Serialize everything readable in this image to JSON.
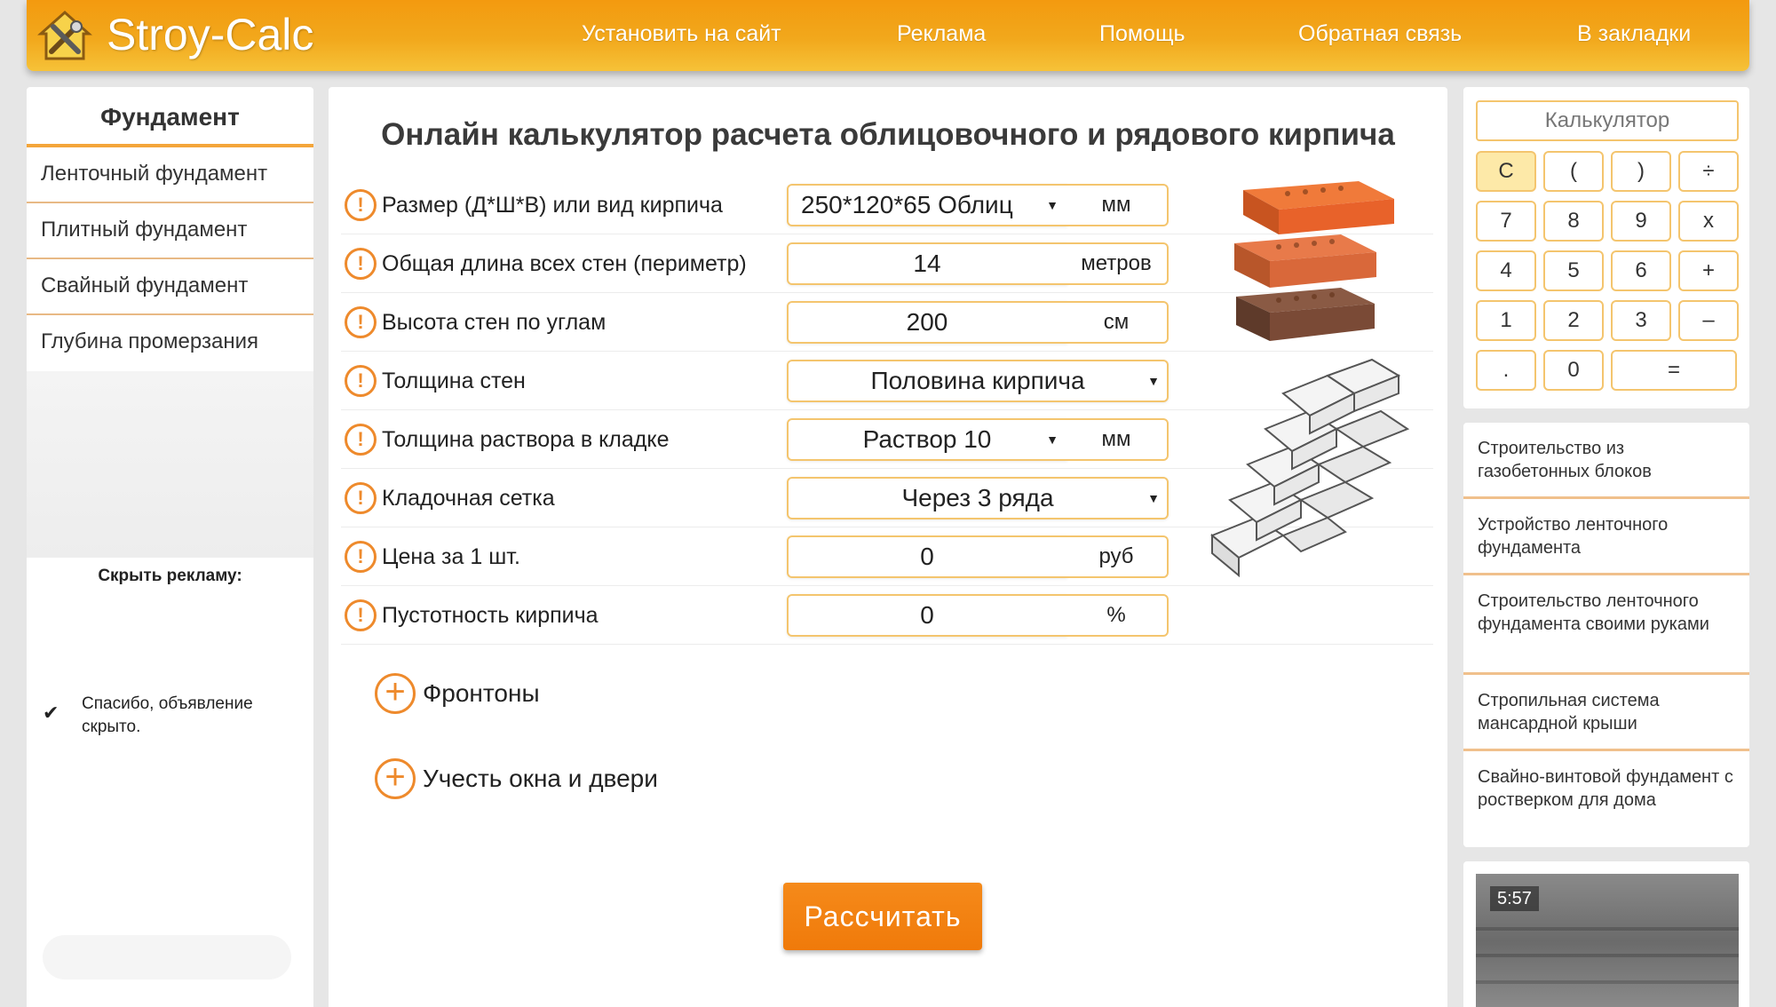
{
  "header": {
    "logo_text": "Stroy-Calc",
    "nav": [
      {
        "label": "Установить на сайт"
      },
      {
        "label": "Реклама"
      },
      {
        "label": "Помощь"
      },
      {
        "label": "Обратная связь"
      },
      {
        "label": "В закладки"
      }
    ],
    "colors": {
      "accent": "#f39a0f"
    }
  },
  "sidebar": {
    "title": "Фундамент",
    "items": [
      {
        "label": "Ленточный фундамент"
      },
      {
        "label": "Плитный фундамент"
      },
      {
        "label": "Свайный фундамент"
      },
      {
        "label": "Глубина промерзания"
      }
    ],
    "hide_ads_label": "Скрыть рекламу:",
    "ad_hidden_message": "Спасибо, объявление скрыто."
  },
  "main": {
    "title": "Онлайн калькулятор расчета облицовочного и рядового кирпича",
    "rows": [
      {
        "label": "Размер (Д*Ш*В) или вид кирпича",
        "value": "250*120*65   Облиц",
        "unit": "мм"
      },
      {
        "label": "Общая длина всех стен (периметр)",
        "value": "14",
        "unit": "метров"
      },
      {
        "label": "Высота стен по углам",
        "value": "200",
        "unit": "см"
      },
      {
        "label": "Толщина стен",
        "value": "Половина кирпича"
      },
      {
        "label": "Толщина раствора в кладке",
        "value": "Раствор 10",
        "unit": "мм"
      },
      {
        "label": "Кладочная сетка",
        "value": "Через 3 ряда"
      },
      {
        "label": "Цена за 1 шт.",
        "value": "0",
        "unit": "руб"
      },
      {
        "label": "Пустотность кирпича",
        "value": "0",
        "unit": "%"
      }
    ],
    "expand_gables": "Фронтоны",
    "expand_windows": "Учесть окна и двери",
    "calculate_button": "Рассчитать",
    "warn_symbol": "!",
    "plus_symbol": "+",
    "dropdown_arrow": "▼"
  },
  "calculator": {
    "display": "Калькулятор",
    "keys": [
      "C",
      "(",
      ")",
      "÷",
      "7",
      "8",
      "9",
      "x",
      "4",
      "5",
      "6",
      "+",
      "1",
      "2",
      "3",
      "–",
      ".",
      "0",
      "="
    ]
  },
  "links": [
    {
      "label": "Строительство из газобетонных блоков"
    },
    {
      "label": "Устройство ленточного фундамента"
    },
    {
      "label": "Строительство ленточного фундамента своими руками"
    },
    {
      "label": "Стропильная система мансардной крыши"
    },
    {
      "label": "Свайно-винтовой фундамент с ростверком для дома"
    }
  ],
  "video": {
    "duration": "5:57"
  },
  "icons": {
    "check": "✔"
  }
}
